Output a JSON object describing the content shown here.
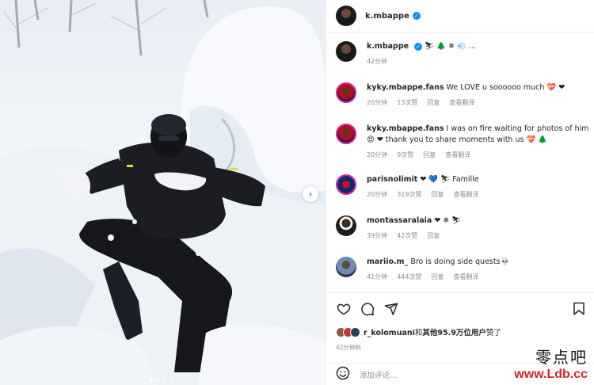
{
  "post": {
    "author": "k.mbappe",
    "caption_emoji": "⛷ 🌲 ❄ 💨 ...",
    "caption_time": "42分钟"
  },
  "comments": [
    {
      "user": "kyky.mbappe.fans",
      "text": "We LOVE u soooooo much 💝 ❤",
      "time": "20分钟",
      "likes": "13次赞",
      "reply": "回复",
      "translate": "查看翻译"
    },
    {
      "user": "kyky.mbappe.fans",
      "text": "I was on fire waiting for photos of him 😍 ❤ thank you to share moments with us 💝 🌲",
      "time": "20分钟",
      "likes": "9次赞",
      "reply": "回复",
      "translate": "查看翻译"
    },
    {
      "user": "parisnolimit",
      "text": "❤ 💙 ⛷ Famille",
      "time": "20分钟",
      "likes": "319次赞",
      "reply": "回复",
      "translate": "查看翻译"
    },
    {
      "user": "montassaralaia",
      "text": "❤ ❄ ⛷",
      "time": "39分钟",
      "likes": "42次赞",
      "reply": "回复",
      "translate": ""
    },
    {
      "user": "mariio.m_",
      "text": "Bro is doing side quests💀",
      "time": "41分钟",
      "likes": "444次赞",
      "reply": "回复",
      "translate": "查看翻译"
    }
  ],
  "likes": {
    "text_user": "r_kolomuani",
    "text_mid": "和",
    "text_others": "其他95.9万位用户",
    "text_end": "赞了"
  },
  "post_time": "42分钟前",
  "add_comment": {
    "placeholder": "添加评论..."
  },
  "watermark": {
    "cn": "零点吧",
    "url": "www.Ldb.cc"
  },
  "icons": [
    "heart-icon",
    "comment-icon",
    "share-icon",
    "bookmark-icon",
    "emoji-icon",
    "verified-icon",
    "chevron-right-icon"
  ],
  "colors": {
    "verified": "#0095f6",
    "meta": "#8e8e8e",
    "watermark_url": "#d8222b"
  },
  "carousel": {
    "count": 4,
    "active": 1
  }
}
